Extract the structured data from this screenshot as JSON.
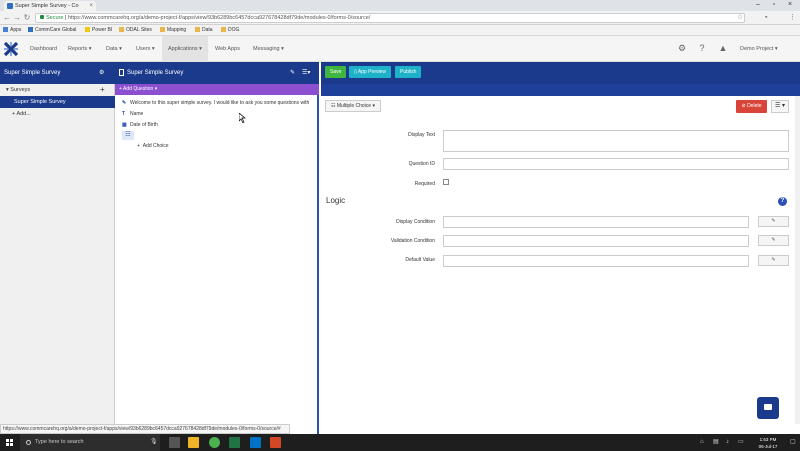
{
  "browser": {
    "tab_title": "Super Simple Survey - Co",
    "security_label": "Secure",
    "url": "https://www.commcarehq.org/a/demo-project-f/apps/view/93b6289bc6457dcca927678428df79de/modules-0/forms-0/source/",
    "bookmarks": [
      "Apps",
      "CommCare Global",
      "Power BI",
      "ODAL Sites",
      "Mapping",
      "Data",
      "DOG"
    ]
  },
  "topnav": {
    "items": [
      "Dashboard",
      "Reports ▾",
      "Data ▾",
      "Users ▾",
      "Applications ▾",
      "Web Apps",
      "Messaging ▾"
    ],
    "project_label": "Demo Project ▾"
  },
  "sidebar": {
    "app_name": "Super Simple Survey",
    "module_name": "Surveys",
    "form_name": "Super Simple Survey",
    "add_label": "Add..."
  },
  "form_pane": {
    "title": "Super Simple Survey",
    "add_question_label": "+ Add Question ▾",
    "questions": [
      {
        "icon": "label-icon",
        "glyph": "✎",
        "text": "Welcome to this super simple survey. I would like to ask you some questions with"
      },
      {
        "icon": "text-icon",
        "glyph": "T",
        "text": "Name"
      },
      {
        "icon": "date-icon",
        "glyph": "▦",
        "text": "Date of Birth"
      }
    ],
    "selected_glyph": "☷",
    "add_choice_label": "Add Choice"
  },
  "editor": {
    "save_label": "Save",
    "preview_label": "App Preview",
    "publish_label": "Publish",
    "question_type": "Multiple Choice ▾",
    "delete_label": "Delete",
    "more_label": "☰ ▾",
    "fields": {
      "display_text": "Display Text",
      "question_id": "Question ID",
      "required": "Required"
    },
    "logic_title": "Logic",
    "logic_fields": [
      "Display Condition",
      "Validation Condition",
      "Default Value"
    ],
    "edit_glyph": "✎"
  },
  "status_url": "https://www.commcarehq.org/a/demo-project-f/apps/view/93b6289bc6457dcca927678428df79de/modules-0/forms-0/source/#",
  "taskbar": {
    "search_placeholder": "Type here to search",
    "time": "1:53 PM",
    "date": "06-Jul-17"
  },
  "colors": {
    "brand_navy": "#1b3a8c",
    "save_green": "#3fb640",
    "action_cyan": "#1eb2c8",
    "delete_red": "#d9443a",
    "add_question_purple": "#8b4fd0"
  }
}
